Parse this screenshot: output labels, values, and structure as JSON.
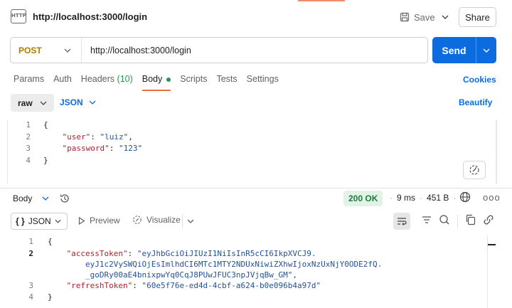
{
  "header": {
    "icon_text": "HTTP",
    "title": "http://localhost:3000/login",
    "save_label": "Save",
    "share_label": "Share"
  },
  "request": {
    "method": "POST",
    "url": "http://localhost:3000/login",
    "send_label": "Send",
    "method_color": "#ad7a03",
    "send_color": "#0c6bdf"
  },
  "tabs": {
    "params": "Params",
    "auth": "Auth",
    "headers": "Headers",
    "headers_count": "(10)",
    "body": "Body",
    "scripts": "Scripts",
    "tests": "Tests",
    "settings": "Settings",
    "active": "Body"
  },
  "cookies_label": "Cookies",
  "body_options": {
    "mode": "raw",
    "language": "JSON",
    "beautify_label": "Beautify"
  },
  "request_body": {
    "lines": [
      {
        "n": "1",
        "text": "{"
      },
      {
        "n": "2",
        "key": "\"user\"",
        "sep": ": ",
        "val": "\"luiz\"",
        "end": ","
      },
      {
        "n": "3",
        "key": "\"password\"",
        "sep": ": ",
        "val": "\"123\"",
        "end": ""
      },
      {
        "n": "4",
        "text": "}"
      }
    ]
  },
  "response": {
    "section_label": "Body",
    "status": "200 OK",
    "time": "9 ms",
    "size": "451 B",
    "more_label": "ooo",
    "view_format": "JSON",
    "view_brace": "{ }",
    "preview_label": "Preview",
    "visualize_label": "Visualize",
    "lines": [
      {
        "n": "1",
        "text": "{"
      },
      {
        "n": "2",
        "key": "\"accessToken\"",
        "val": "\"eyJhbGciOiJIUzI1NiIsInR5cCI6IkpXVCJ9."
      },
      {
        "n": "",
        "cont": "eyJ1c2VySWQiOjEsImlhdCI6MTc1MTY2NDUxNiwiZXhwIjoxNzUxNjY0ODE2fQ."
      },
      {
        "n": "",
        "cont": "_goDRy00aE4bnixpwYq0CqJ8PUwJFUC3npJVjqBw_GM\","
      },
      {
        "n": "3",
        "key": "\"refreshToken\"",
        "val": "\"60e5f76e-ed4d-4cbf-a624-b0e096b4a97d\""
      },
      {
        "n": "4",
        "text": "}"
      }
    ]
  },
  "colors": {
    "key": "#b21f2f",
    "string": "#22529b",
    "active_tab_underline": "#f26b3a",
    "status_ok": "#1f7a3e"
  }
}
